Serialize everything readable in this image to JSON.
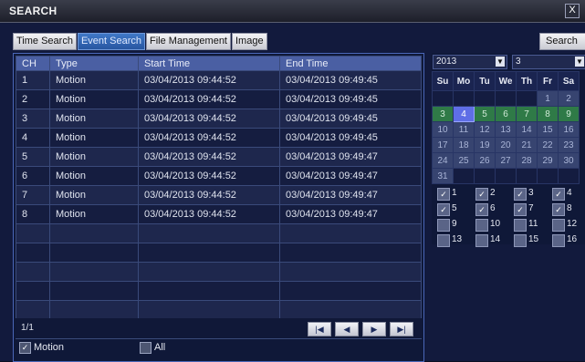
{
  "window": {
    "title": "SEARCH",
    "close_label": "X"
  },
  "tabs": [
    {
      "label": "Time Search",
      "active": false
    },
    {
      "label": "Event Search",
      "active": true
    },
    {
      "label": "File Management",
      "active": false
    },
    {
      "label": "Image",
      "active": false
    }
  ],
  "search_button": "Search",
  "table": {
    "columns": [
      "CH",
      "Type",
      "Start Time",
      "End Time"
    ],
    "rows": [
      [
        "1",
        "Motion",
        "03/04/2013 09:44:52",
        "03/04/2013 09:49:45"
      ],
      [
        "2",
        "Motion",
        "03/04/2013 09:44:52",
        "03/04/2013 09:49:45"
      ],
      [
        "3",
        "Motion",
        "03/04/2013 09:44:52",
        "03/04/2013 09:49:45"
      ],
      [
        "4",
        "Motion",
        "03/04/2013 09:44:52",
        "03/04/2013 09:49:45"
      ],
      [
        "5",
        "Motion",
        "03/04/2013 09:44:52",
        "03/04/2013 09:49:47"
      ],
      [
        "6",
        "Motion",
        "03/04/2013 09:44:52",
        "03/04/2013 09:49:47"
      ],
      [
        "7",
        "Motion",
        "03/04/2013 09:44:52",
        "03/04/2013 09:49:47"
      ],
      [
        "8",
        "Motion",
        "03/04/2013 09:44:52",
        "03/04/2013 09:49:47"
      ],
      [
        "",
        "",
        "",
        ""
      ],
      [
        "",
        "",
        "",
        ""
      ],
      [
        "",
        "",
        "",
        ""
      ],
      [
        "",
        "",
        "",
        ""
      ],
      [
        "",
        "",
        "",
        ""
      ],
      [
        "",
        "",
        "",
        ""
      ]
    ]
  },
  "pager": {
    "page_info": "1/1",
    "buttons": [
      "first-page",
      "prev-page",
      "next-page",
      "last-page"
    ],
    "glyphs": [
      "|◀",
      "◀",
      "▶",
      "▶|"
    ]
  },
  "filters": [
    {
      "label": "Motion",
      "checked": true
    },
    {
      "label": "All",
      "checked": false
    }
  ],
  "calendar": {
    "year": "2013",
    "month": "3",
    "weekdays": [
      "Su",
      "Mo",
      "Tu",
      "We",
      "Th",
      "Fr",
      "Sa"
    ],
    "weeks": [
      [
        "",
        "",
        "",
        "",
        "",
        "1",
        "2"
      ],
      [
        "3",
        "4",
        "5",
        "6",
        "7",
        "8",
        "9"
      ],
      [
        "10",
        "11",
        "12",
        "13",
        "14",
        "15",
        "16"
      ],
      [
        "17",
        "18",
        "19",
        "20",
        "21",
        "22",
        "23"
      ],
      [
        "24",
        "25",
        "26",
        "27",
        "28",
        "29",
        "30"
      ],
      [
        "31",
        "",
        "",
        "",
        "",
        "",
        ""
      ]
    ],
    "record_days": [
      "3",
      "5",
      "6",
      "7",
      "8",
      "9"
    ],
    "selected_day": "4"
  },
  "channels": [
    {
      "label": "1",
      "checked": true
    },
    {
      "label": "2",
      "checked": true
    },
    {
      "label": "3",
      "checked": true
    },
    {
      "label": "4",
      "checked": true
    },
    {
      "label": "5",
      "checked": true
    },
    {
      "label": "6",
      "checked": true
    },
    {
      "label": "7",
      "checked": true
    },
    {
      "label": "8",
      "checked": true
    },
    {
      "label": "9",
      "checked": false
    },
    {
      "label": "10",
      "checked": false
    },
    {
      "label": "11",
      "checked": false
    },
    {
      "label": "12",
      "checked": false
    },
    {
      "label": "13",
      "checked": false
    },
    {
      "label": "14",
      "checked": false
    },
    {
      "label": "15",
      "checked": false
    },
    {
      "label": "16",
      "checked": false
    }
  ]
}
